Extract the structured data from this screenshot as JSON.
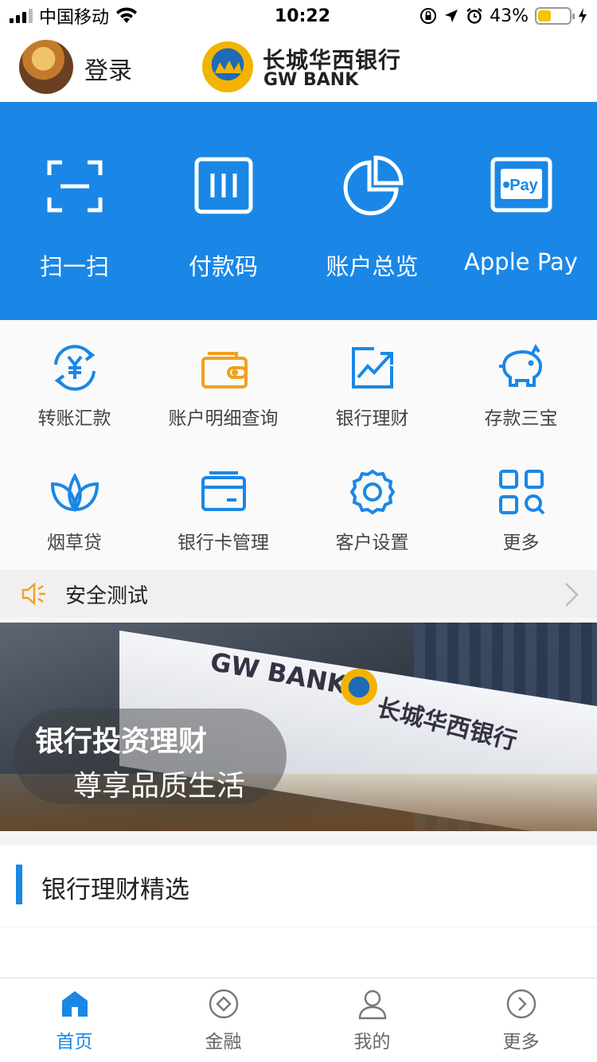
{
  "status_bar": {
    "carrier": "中国移动",
    "time": "10:22",
    "battery": "43%",
    "battery_level": 0.43
  },
  "header": {
    "login_label": "登录",
    "bank_name_cn": "长城华西银行",
    "bank_name_en": "GW BANK"
  },
  "quick_actions": [
    {
      "label": "扫一扫",
      "icon": "scan-icon"
    },
    {
      "label": "付款码",
      "icon": "payment-code-icon"
    },
    {
      "label": "账户总览",
      "icon": "pie-chart-icon"
    },
    {
      "label": "Apple Pay",
      "icon": "apple-pay-icon",
      "icon_text": "Pay"
    }
  ],
  "services": [
    {
      "label": "转账汇款",
      "icon": "transfer-icon"
    },
    {
      "label": "账户明细查询",
      "icon": "wallet-icon"
    },
    {
      "label": "银行理财",
      "icon": "trend-chart-icon"
    },
    {
      "label": "存款三宝",
      "icon": "piggy-bank-icon"
    },
    {
      "label": "烟草贷",
      "icon": "leaf-icon"
    },
    {
      "label": "银行卡管理",
      "icon": "card-icon"
    },
    {
      "label": "客户设置",
      "icon": "gear-icon"
    },
    {
      "label": "更多",
      "icon": "more-grid-icon"
    }
  ],
  "notice": {
    "text": "安全测试"
  },
  "banner": {
    "title": "银行投资理财",
    "subtitle": "尊享品质生活",
    "sign_en": "GW BANK",
    "sign_cn": "长城华西银行"
  },
  "section": {
    "title": "银行理财精选"
  },
  "tabs": [
    {
      "label": "首页",
      "icon": "home-icon",
      "active": true
    },
    {
      "label": "金融",
      "icon": "finance-icon",
      "active": false
    },
    {
      "label": "我的",
      "icon": "user-icon",
      "active": false
    },
    {
      "label": "更多",
      "icon": "more-arrow-icon",
      "active": false
    }
  ],
  "colors": {
    "primary": "#1a87e6",
    "accent_orange": "#f0a020",
    "rate_orange": "#ff6a1a"
  }
}
